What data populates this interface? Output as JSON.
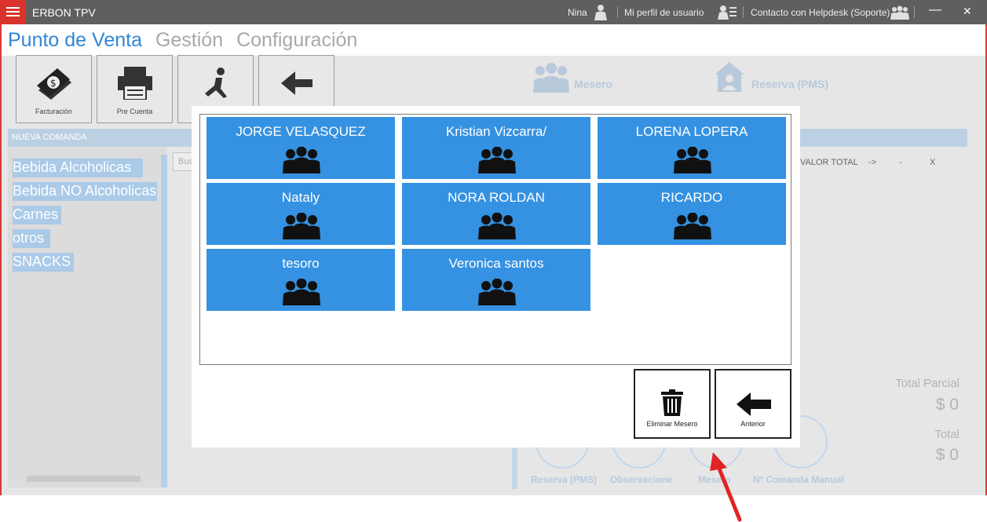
{
  "window": {
    "title": "ERBON TPV",
    "user": "Nina",
    "profile": "Mi perfil de usuario",
    "helpdesk": "Contacto con Helpdesk (Soporte)",
    "minimize": "—",
    "close": "✕"
  },
  "nav": {
    "tabs": [
      "Punto de Venta",
      "Gestión",
      "Configuración"
    ]
  },
  "toolbar": {
    "billing": "Facturación",
    "pre_bill": "Pre Cuenta"
  },
  "background": {
    "mesero_label": "Mesero",
    "reserva_label": "Reserva (PMS)",
    "nueva_comanda": "NUEVA COMANDA",
    "categories": [
      "Bebida Alcoholicas",
      "Bebida NO Alcoholicas",
      "Carnes",
      "otros",
      "SNACKS"
    ],
    "search_placeholder": "Bus",
    "columns": [
      "VALOR TOTAL",
      "->",
      "-",
      "X"
    ],
    "total_parcial_label": "Total Parcial",
    "total_parcial_value": "$ 0",
    "total_label": "Total",
    "total_value": "$ 0",
    "bottom_buttons": [
      "Reserva (PMS)",
      "Observaciones",
      "Mesero",
      "Nº Comanda Manual"
    ]
  },
  "modal": {
    "waiters": [
      "JORGE VELASQUEZ",
      "Kristian Vizcarra/",
      "LORENA LOPERA",
      "Nataly",
      "NORA ROLDAN",
      "RICARDO",
      "tesoro",
      "Veronica santos"
    ],
    "delete_button": "Eliminar Mesero",
    "back_button": "Anterior"
  },
  "colors": {
    "accent": "#3592e2",
    "titlebar": "#5f5f5f",
    "menu": "#d9332b",
    "annotation_arrow": "#e02424"
  }
}
